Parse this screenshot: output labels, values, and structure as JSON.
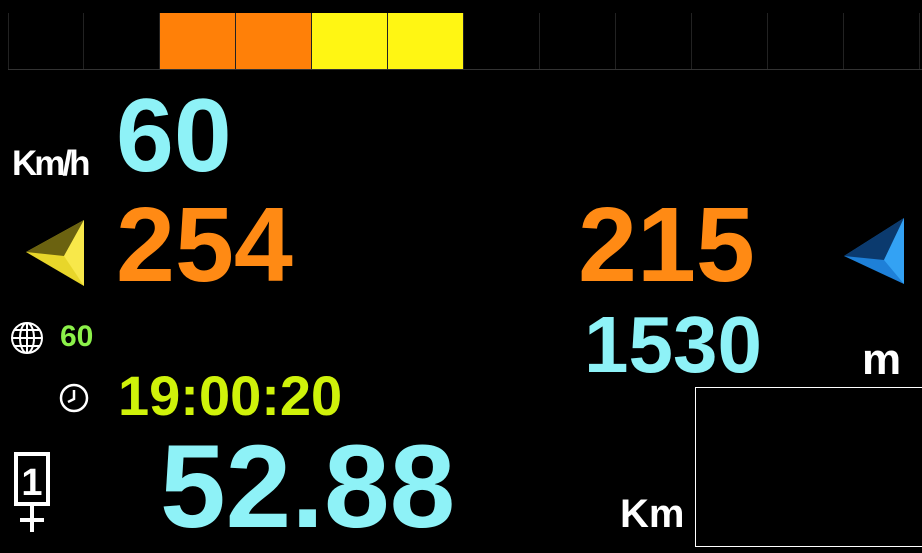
{
  "top_bar": {
    "cells": [
      "",
      "",
      "orange",
      "orange",
      "yellow",
      "yellow",
      "",
      "",
      "",
      "",
      "",
      ""
    ],
    "colors": {
      "orange": "#ff8008",
      "yellow": "#fff613"
    }
  },
  "speed": {
    "value": "60",
    "unit": "Km/h"
  },
  "heading_left": {
    "value": "254",
    "icon": "yellow-direction-arrow-icon"
  },
  "heading_right": {
    "value": "215",
    "icon": "blue-direction-arrow-icon"
  },
  "globe": {
    "value": "60",
    "icon": "globe-icon"
  },
  "altitude": {
    "value": "1530",
    "unit": "m"
  },
  "clock": {
    "time": "19:00:20",
    "icon": "clock-icon"
  },
  "distance": {
    "value": "52.88",
    "unit": "Km",
    "icon": "waypoint-number-icon",
    "badge": "1"
  }
}
